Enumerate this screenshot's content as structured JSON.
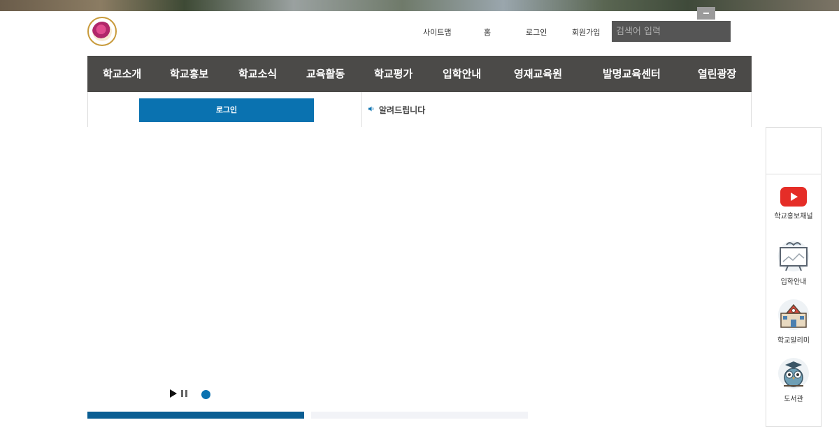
{
  "header": {
    "util_links": [
      "사이트맵",
      "홈",
      "로그인",
      "회원가입"
    ],
    "search_placeholder": "검색어 입력"
  },
  "gnb": {
    "items": [
      "학교소개",
      "학교홍보",
      "학교소식",
      "교육활동",
      "학교평가",
      "입학안내",
      "영재교육원",
      "발명교육센터",
      "열린광장"
    ]
  },
  "login_panel": {
    "button_label": "로그인"
  },
  "notice": {
    "title": "알려드립니다"
  },
  "quick_menu": {
    "items": [
      {
        "label": "학교홍보채널",
        "icon": "youtube-icon"
      },
      {
        "label": "입학안내",
        "icon": "presentation-board-icon"
      },
      {
        "label": "학교알리미",
        "icon": "school-building-icon"
      },
      {
        "label": "도서관",
        "icon": "owl-icon"
      }
    ]
  },
  "colors": {
    "accent": "#0a72b0",
    "nav_bg": "#4b4a48",
    "search_bg": "#555555"
  }
}
